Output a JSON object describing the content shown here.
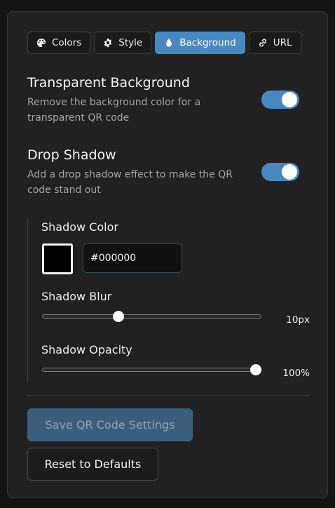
{
  "tabs": [
    {
      "label": "Colors",
      "icon": "palette-icon",
      "active": false
    },
    {
      "label": "Style",
      "icon": "gear-icon",
      "active": false
    },
    {
      "label": "Background",
      "icon": "droplet-icon",
      "active": true
    },
    {
      "label": "URL",
      "icon": "link-icon",
      "active": false
    }
  ],
  "transparent": {
    "title": "Transparent Background",
    "description": "Remove the background color for a transparent QR code",
    "enabled": true
  },
  "shadow": {
    "title": "Drop Shadow",
    "description": "Add a drop shadow effect to make the QR code stand out",
    "enabled": true,
    "color_label": "Shadow Color",
    "color_value": "#000000",
    "blur_label": "Shadow Blur",
    "blur_value": "10px",
    "blur_fraction": 0.34,
    "opacity_label": "Shadow Opacity",
    "opacity_value": "100%",
    "opacity_fraction": 1.0
  },
  "buttons": {
    "save": "Save QR Code Settings",
    "reset": "Reset to Defaults"
  },
  "colors": {
    "accent": "#4a88c2",
    "panel": "#212121",
    "background": "#141414"
  }
}
